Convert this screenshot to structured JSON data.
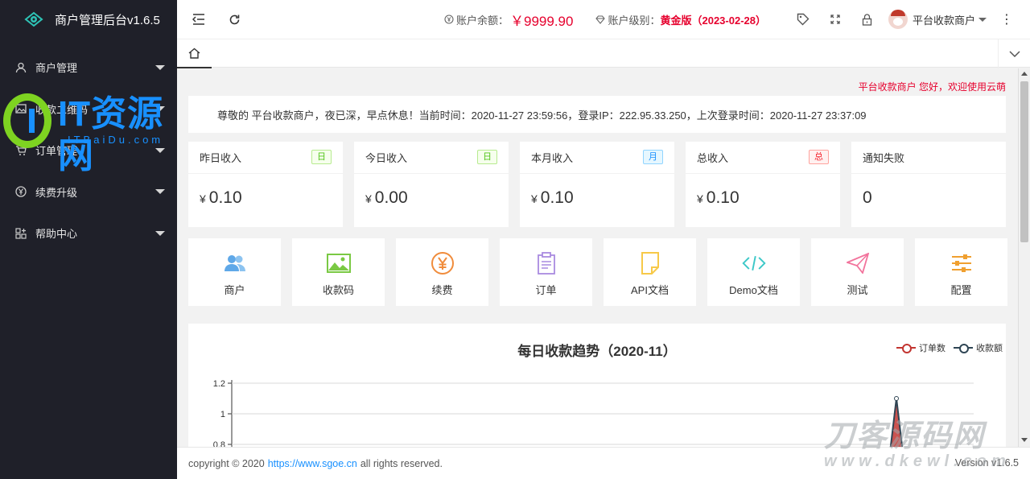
{
  "app": {
    "title": "商户管理后台v1.6.5"
  },
  "sidebar": {
    "items": [
      {
        "label": "商户管理",
        "icon": "user-icon"
      },
      {
        "label": "收款二维码",
        "icon": "image-icon"
      },
      {
        "label": "订单管理",
        "icon": "cart-icon"
      },
      {
        "label": "续费升级",
        "icon": "yen-icon"
      },
      {
        "label": "帮助中心",
        "icon": "apps-icon"
      }
    ]
  },
  "header": {
    "balance_label": "账户余额：",
    "balance_value": "￥9999.90",
    "level_label": "账户级别：",
    "level_value": "黄金版（2023-02-28）",
    "username": "平台收款商户"
  },
  "marquee": {
    "text": "平台收款商户 您好，欢迎使用云萌"
  },
  "notice": {
    "text": "尊敬的 平台收款商户，夜已深，早点休息！当前时间：2020-11-27 23:59:56，登录IP：222.95.33.250，上次登录时间：2020-11-27 23:37:09"
  },
  "stats": [
    {
      "label": "昨日收入",
      "badge": "日",
      "badge_style": "green",
      "currency": "¥",
      "value": "0.10"
    },
    {
      "label": "今日收入",
      "badge": "日",
      "badge_style": "green",
      "currency": "¥",
      "value": "0.00"
    },
    {
      "label": "本月收入",
      "badge": "月",
      "badge_style": "blue",
      "currency": "¥",
      "value": "0.10"
    },
    {
      "label": "总收入",
      "badge": "总",
      "badge_style": "red",
      "currency": "¥",
      "value": "0.10"
    },
    {
      "label": "通知失败",
      "badge": "",
      "badge_style": "",
      "currency": "",
      "value": "0"
    }
  ],
  "shortcuts": [
    {
      "label": "商户",
      "icon": "users-icon",
      "color": "#5fa8e8"
    },
    {
      "label": "收款码",
      "icon": "picture-icon",
      "color": "#7ac943"
    },
    {
      "label": "续费",
      "icon": "yen-circle-icon",
      "color": "#f08c3c"
    },
    {
      "label": "订单",
      "icon": "clipboard-icon",
      "color": "#a98be0"
    },
    {
      "label": "API文档",
      "icon": "document-icon",
      "color": "#f7c948"
    },
    {
      "label": "Demo文档",
      "icon": "code-icon",
      "color": "#3cc8c8"
    },
    {
      "label": "测试",
      "icon": "send-icon",
      "color": "#f2739c"
    },
    {
      "label": "配置",
      "icon": "sliders-icon",
      "color": "#f0a030"
    }
  ],
  "chart_data": {
    "type": "line",
    "title": "每日收款趋势（2020-11）",
    "series": [
      {
        "name": "订单数",
        "color": "#c23531"
      },
      {
        "name": "收款额",
        "color": "#2f4554"
      }
    ],
    "y_ticks": [
      "1.2",
      "1",
      "0.8"
    ],
    "ylim": [
      0.8,
      1.2
    ],
    "peak_value": 1.1,
    "grid": true,
    "legend": "top-right"
  },
  "footer": {
    "prefix": "copyright © 2020",
    "link": "https://www.sgoe.cn",
    "suffix": "all rights reserved.",
    "version": "Version v1.6.5"
  },
  "watermarks": {
    "top_main": "IT资源网",
    "top_sub": "ITBaiDu.com",
    "bottom_main": "刀客源码网",
    "bottom_sub": "www.dkewl.com"
  }
}
